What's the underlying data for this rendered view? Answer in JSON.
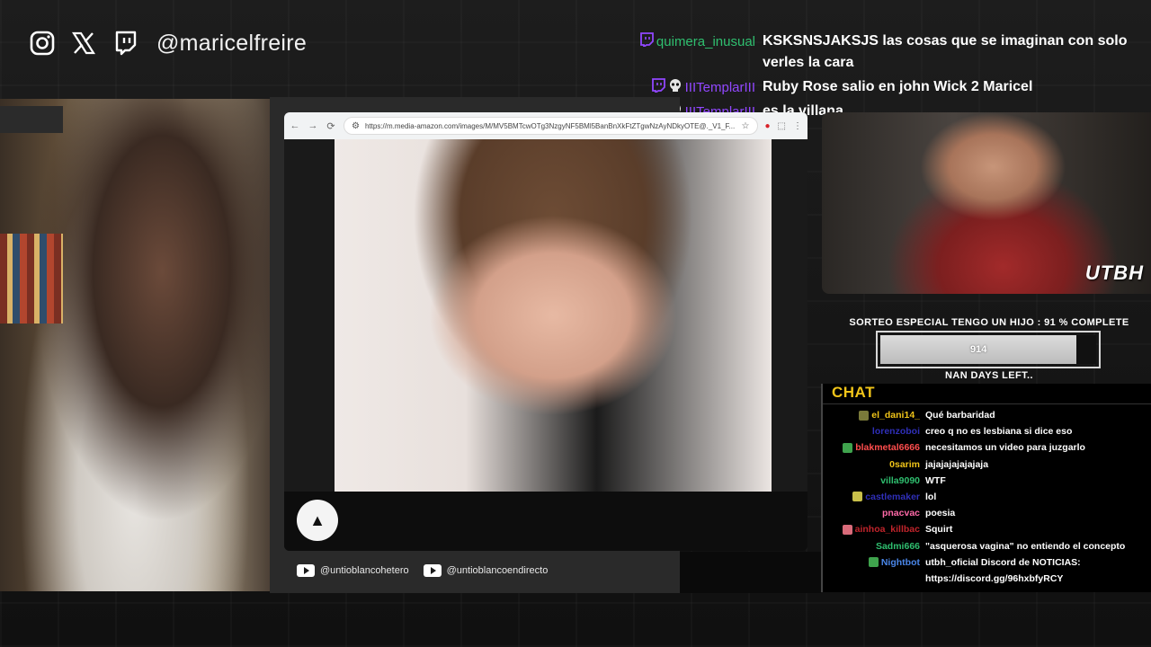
{
  "header": {
    "handle": "@maricelfreire",
    "icons": [
      "instagram-icon",
      "x-icon",
      "twitch-icon"
    ]
  },
  "top_chat": [
    {
      "user": "quimera_inusual",
      "user_color": "#2fbf6f",
      "badges": [
        "twitch"
      ],
      "message": "KSKSNSJAKSJS las cosas que se imaginan con solo verles la cara"
    },
    {
      "user": "IIITemplarIII",
      "user_color": "#9147ff",
      "badges": [
        "twitch",
        "skull"
      ],
      "message": "Ruby Rose salio en john Wick 2 Maricel"
    },
    {
      "user": "IIITemplarIII",
      "user_color": "#9147ff",
      "badges": [
        "twitch",
        "skull"
      ],
      "message": "es la villana"
    }
  ],
  "browser": {
    "url": "https://m.media-amazon.com/images/M/MV5BMTcwOTg3NzgyNF5BMl5BanBnXkFtZTgwNzAyNDkyOTE@._V1_F..."
  },
  "youtube": {
    "channels": [
      "@untioblancohetero",
      "@untioblancoendirecto"
    ]
  },
  "right_cam": {
    "tag": "UTBH"
  },
  "sorteo": {
    "title": "SORTEO ESPECIAL TENGO UN HIJO :  91 % COMPLETE",
    "progress_label": "914",
    "progress_fraction": 0.91,
    "days_left": "NAN DAYS LEFT.."
  },
  "chat": {
    "title": "CHAT",
    "messages": [
      {
        "user": "el_dani14_",
        "color": "#f0c419",
        "badge": "#7a7a3a",
        "message": "Qué barbaridad"
      },
      {
        "user": "lorenzoboi",
        "color": "#2f2fb8",
        "badge": "",
        "message": "creo q no es lesbiana si dice eso"
      },
      {
        "user": "blakmetal6666",
        "color": "#ff4d4d",
        "badge": "#3fa34d",
        "message": "necesitamos un video para juzgarlo"
      },
      {
        "user": "0sarim",
        "color": "#f0c419",
        "badge": "",
        "message": "jajajajajajajaja"
      },
      {
        "user": "villa9090",
        "color": "#2fbf6f",
        "badge": "",
        "message": "WTF"
      },
      {
        "user": "castlemaker",
        "color": "#2f2fb8",
        "badge": "#c9c04a",
        "message": "lol"
      },
      {
        "user": "pnacvac",
        "color": "#ff6aa8",
        "badge": "",
        "message": "poesia"
      },
      {
        "user": "ainhoa_killbac",
        "color": "#c0242b",
        "badge": "#d96b7a",
        "message": "Squirt"
      },
      {
        "user": "Sadmi666",
        "color": "#2fbf6f",
        "badge": "",
        "message": "\"asquerosa vagina\" no entiendo el concepto"
      },
      {
        "user": "Nightbot",
        "color": "#4a86e8",
        "badge": "#3fa34d",
        "message": "utbh_oficial Discord de NOTICIAS: https://discord.gg/96hxbfyRCY"
      }
    ]
  }
}
